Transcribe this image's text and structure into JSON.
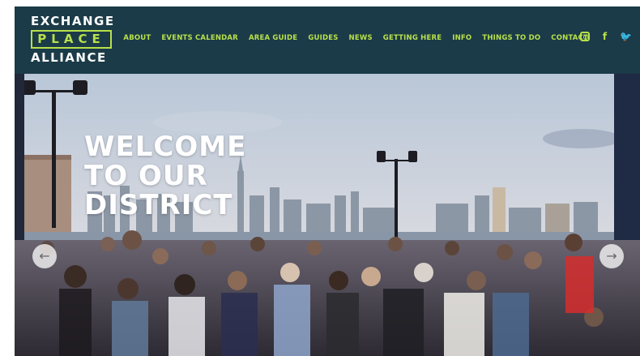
{
  "logo": {
    "line1": "EXCHANGE",
    "line2": "PLACE",
    "line3": "ALLIANCE"
  },
  "nav": {
    "about": "ABOUT",
    "events_calendar": "EVENTS CALENDAR",
    "area_guide": "AREA GUIDE",
    "guides": "GUIDES",
    "news": "NEWS",
    "getting_here": "GETTING HERE",
    "info": "INFO",
    "things_to_do": "THINGS TO DO",
    "contact": "CONTACT"
  },
  "social": {
    "facebook_glyph": "f",
    "twitter_glyph": "🐦"
  },
  "hero": {
    "title_line1": "WELCOME",
    "title_line2": "TO OUR",
    "title_line3": "DISTRICT",
    "prev_glyph": "←",
    "next_glyph": "→"
  },
  "colors": {
    "header_bg": "#1b3b48",
    "accent": "#b8e04a",
    "title": "#ffffff"
  },
  "icons": [
    "instagram-icon",
    "facebook-icon",
    "twitter-icon",
    "arrow-left-icon",
    "arrow-right-icon"
  ]
}
